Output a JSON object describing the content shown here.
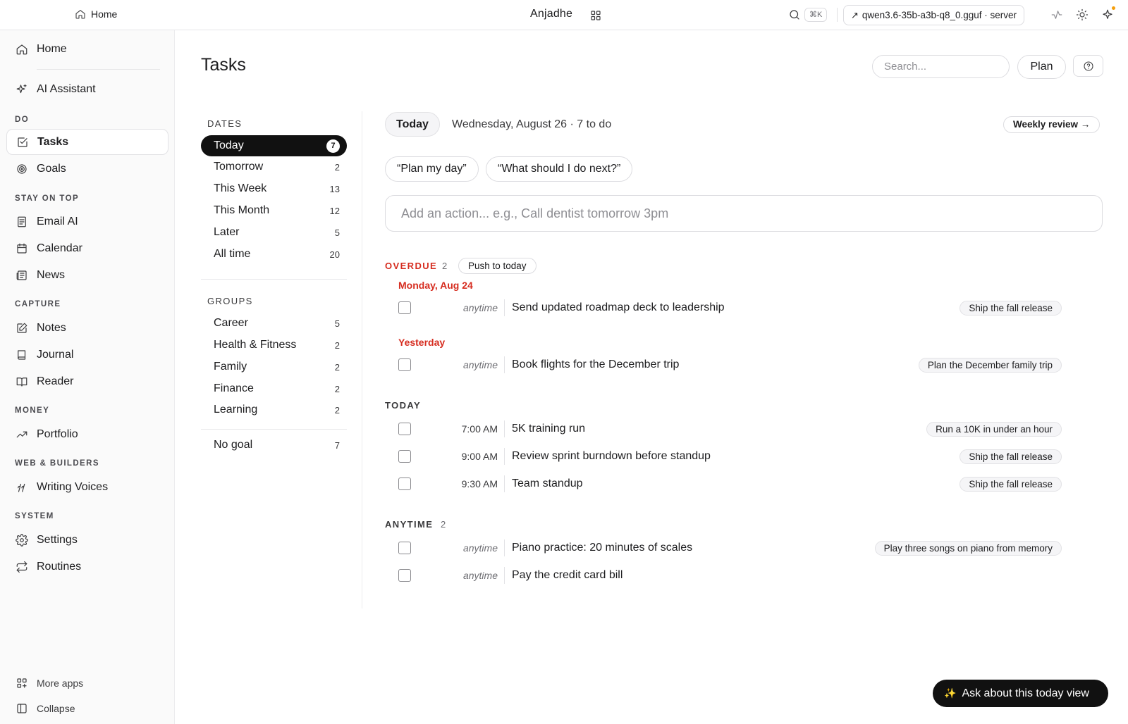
{
  "topbar": {
    "home_label": "Home",
    "brand": "Anjadhe",
    "kbd": "⌘K",
    "model_label": "qwen3.6-35b-a3b-q8_0.gguf · server"
  },
  "sidebar": {
    "home": "Home",
    "assistant": "AI Assistant",
    "sec_do": "DO",
    "tasks": "Tasks",
    "goals": "Goals",
    "sec_stay": "STAY ON TOP",
    "email": "Email AI",
    "calendar": "Calendar",
    "news": "News",
    "sec_capture": "CAPTURE",
    "notes": "Notes",
    "journal": "Journal",
    "reader": "Reader",
    "sec_money": "MONEY",
    "portfolio": "Portfolio",
    "sec_web": "WEB & BUILDERS",
    "voices": "Writing Voices",
    "sec_system": "SYSTEM",
    "settings": "Settings",
    "routines": "Routines",
    "more_apps": "More apps",
    "collapse": "Collapse"
  },
  "header": {
    "title": "Tasks",
    "search_placeholder": "Search...",
    "plan": "Plan"
  },
  "filters": {
    "dates_label": "DATES",
    "dates": [
      {
        "label": "Today",
        "count": "7"
      },
      {
        "label": "Tomorrow",
        "count": "2"
      },
      {
        "label": "This Week",
        "count": "13"
      },
      {
        "label": "This Month",
        "count": "12"
      },
      {
        "label": "Later",
        "count": "5"
      },
      {
        "label": "All time",
        "count": "20"
      }
    ],
    "groups_label": "GROUPS",
    "groups": [
      {
        "label": "Career",
        "count": "5"
      },
      {
        "label": "Health & Fitness",
        "count": "2"
      },
      {
        "label": "Family",
        "count": "2"
      },
      {
        "label": "Finance",
        "count": "2"
      },
      {
        "label": "Learning",
        "count": "2"
      }
    ],
    "no_goal": {
      "label": "No goal",
      "count": "7"
    }
  },
  "content": {
    "today_pill": "Today",
    "date_sub": "Wednesday, August 26 · 7 to do",
    "weekly_review": "Weekly review →",
    "suggestions": [
      "“Plan my day”",
      "“What should I do next?”"
    ],
    "add_placeholder": "Add an action... e.g., Call dentist tomorrow 3pm",
    "overdue": {
      "label": "OVERDUE",
      "count": "2",
      "push": "Push to today",
      "day1": "Monday, Aug 24",
      "day2": "Yesterday"
    },
    "today_label": "TODAY",
    "anytime_label": "ANYTIME",
    "anytime_count": "2",
    "tasks": [
      {
        "time": "anytime",
        "title": "Send updated roadmap deck to leadership",
        "goal": "Ship the fall release"
      },
      {
        "time": "anytime",
        "title": "Book flights for the December trip",
        "goal": "Plan the December family trip"
      },
      {
        "time": "7:00 AM",
        "title": "5K training run",
        "goal": "Run a 10K in under an hour"
      },
      {
        "time": "9:00 AM",
        "title": "Review sprint burndown before standup",
        "goal": "Ship the fall release"
      },
      {
        "time": "9:30 AM",
        "title": "Team standup",
        "goal": "Ship the fall release"
      },
      {
        "time": "anytime",
        "title": "Piano practice: 20 minutes of scales",
        "goal": "Play three songs on piano from memory"
      },
      {
        "time": "anytime",
        "title": "Pay the credit card bill",
        "goal": ""
      }
    ]
  },
  "ask_button": "Ask about this today view",
  "colors": {
    "accent_dark": "#111111",
    "overdue_red": "#d62d20",
    "sparkle": "#f5c542",
    "notification_dot": "#f59e0b"
  }
}
